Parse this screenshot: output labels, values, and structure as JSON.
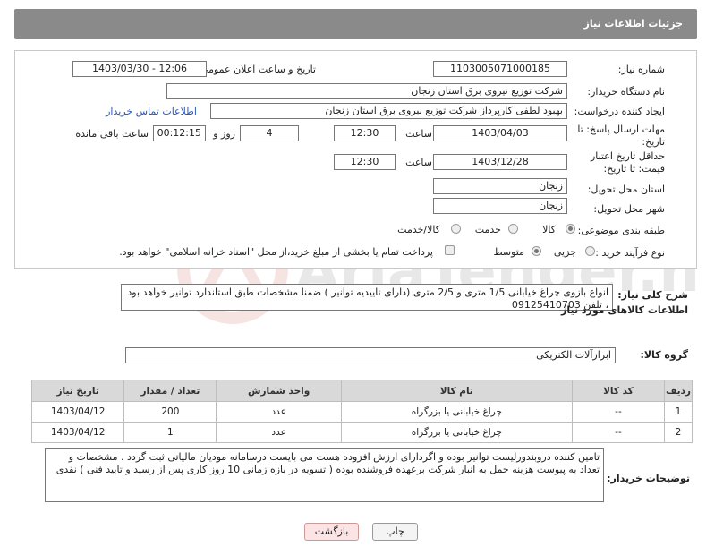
{
  "header": {
    "title": "جزئیات اطلاعات نیاز"
  },
  "form": {
    "need_number_label": "شماره نیاز:",
    "need_number": "1103005071000185",
    "announce_label": "تاریخ و ساعت اعلان عمومی:",
    "announce_value": "1403/03/30 - 12:06",
    "buyer_org_label": "نام دستگاه خریدار:",
    "buyer_org": "شرکت توزیع نیروی برق استان زنجان",
    "creator_label": "ایجاد کننده درخواست:",
    "creator": "بهبود لطفی کارپرداز شرکت توزیع نیروی برق استان زنجان",
    "contact_link": "اطلاعات تماس خریدار",
    "deadline_label": "مهلت ارسال پاسخ: تا تاریخ:",
    "deadline_date": "1403/04/03",
    "time_label": "ساعت",
    "deadline_time": "12:30",
    "days_value": "4",
    "days_label": "روز و",
    "remaining_time": "00:12:15",
    "remaining_label": "ساعت باقی مانده",
    "price_validity_label": "حداقل تاریخ اعتبار قیمت: تا تاریخ:",
    "price_validity_date": "1403/12/28",
    "price_validity_time": "12:30",
    "province_label": "استان محل تحویل:",
    "province": "زنجان",
    "city_label": "شهر محل تحویل:",
    "city": "زنجان",
    "category_label": "طبقه بندی موضوعی:",
    "category_options": [
      "کالا",
      "خدمت",
      "کالا/خدمت"
    ],
    "process_label": "نوع فرآیند خرید :",
    "process_options": [
      "جزیی",
      "متوسط"
    ],
    "payment_note": "پرداخت تمام یا بخشی از مبلغ خرید،از محل \"اسناد خزانه اسلامی\" خواهد بود."
  },
  "summary": {
    "label": "شرح کلی نیاز:",
    "text": "انواع بازوی چراغ خیابانی 1/5 متری و 2/5 متری (دارای تاییدیه توانیر ) ضمنا مشخصات طبق استاندارد توانیر خواهد بود ، تلفن 09125410703"
  },
  "goods": {
    "title": "اطلاعات کالاهای مورد نیاز",
    "group_label": "گروه کالا:",
    "group_value": "ابزارآلات الکتریکی",
    "columns": [
      "ردیف",
      "کد کالا",
      "نام کالا",
      "واحد شمارش",
      "تعداد / مقدار",
      "تاریخ نیاز"
    ],
    "rows": [
      [
        "1",
        "--",
        "چراغ خیابانی یا بزرگراه",
        "عدد",
        "200",
        "1403/04/12"
      ],
      [
        "2",
        "--",
        "چراغ خیابانی یا بزرگراه",
        "عدد",
        "1",
        "1403/04/12"
      ]
    ]
  },
  "buyer_notes": {
    "label": "توضیحات خریدار:",
    "text": "تامین کننده دروبندورلیست توانیر بوده و اگردارای ارزش افزوده هست می بایست درسامانه مودیان مالیاتی ثبت گردد . مشخصات و تعداد به پیوست هزینه حمل به انبار شرکت برعهده فروشنده بوده ( تسویه در بازه زمانی 10 روز کاری پس از رسید و تایید فنی ) نقدی"
  },
  "buttons": {
    "print": "چاپ",
    "back": "بازگشت"
  },
  "watermark": "AriaTender.net",
  "colors": {
    "header_bg": "#8a8a8a",
    "link": "#2b57b5",
    "back_button_bg": "#fde4e4"
  }
}
